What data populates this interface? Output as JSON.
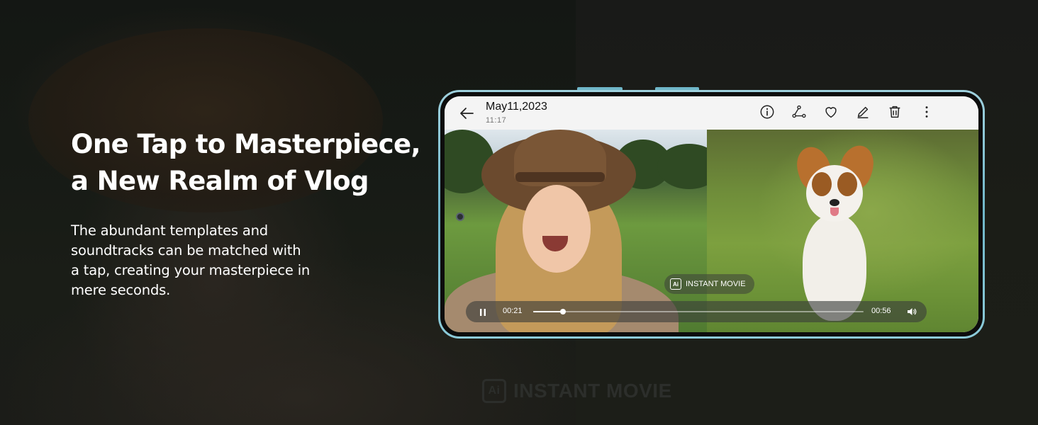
{
  "hero": {
    "title_lines": [
      "One Tap to Masterpiece,",
      "a New Realm of Vlog"
    ],
    "body_lines": [
      "The abundant templates and",
      "soundtracks can be matched with",
      "a tap, creating your masterpiece in",
      "mere seconds."
    ]
  },
  "background": {
    "watermark_icon_text": "Ai",
    "watermark_label": "INSTANT MOVIE"
  },
  "gallery": {
    "date": "May11,2023",
    "time": "11:17",
    "actions": [
      {
        "name": "info",
        "icon": "info-icon"
      },
      {
        "name": "share",
        "icon": "share-icon"
      },
      {
        "name": "favorite",
        "icon": "heart-icon"
      },
      {
        "name": "edit",
        "icon": "edit-icon"
      },
      {
        "name": "delete",
        "icon": "trash-icon"
      },
      {
        "name": "more",
        "icon": "more-vertical-icon"
      }
    ],
    "chip": {
      "icon_text": "Ai",
      "label": "INSTANT MOVIE"
    },
    "player": {
      "current_time": "00:21",
      "total_time": "00:56",
      "progress": 0.09,
      "state": "playing"
    }
  },
  "colors": {
    "phone_frame": "#8ccbd9",
    "page_background": "#141614",
    "headline": "#ffffff"
  }
}
